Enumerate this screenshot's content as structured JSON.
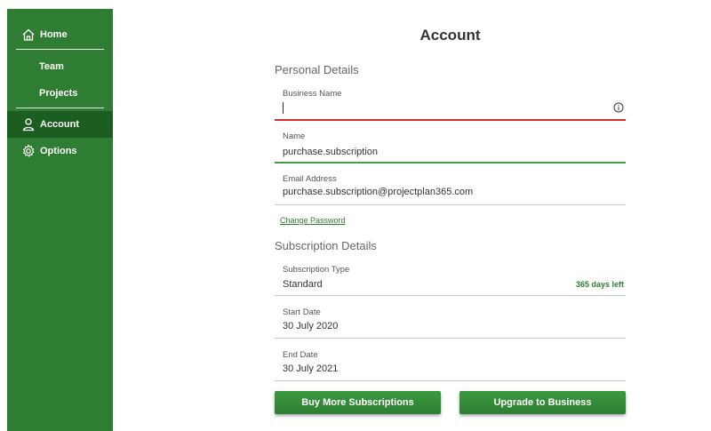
{
  "sidebar": {
    "items": [
      {
        "label": "Home",
        "icon": "home-icon"
      },
      {
        "label": "Team"
      },
      {
        "label": "Projects"
      },
      {
        "label": "Account",
        "icon": "person-icon",
        "active": true
      },
      {
        "label": "Options",
        "icon": "gear-icon"
      }
    ]
  },
  "main": {
    "title": "Account",
    "personal_section": "Personal Details",
    "business_name": {
      "label": "Business Name",
      "value": ""
    },
    "name": {
      "label": "Name",
      "value": "purchase.subscription"
    },
    "email": {
      "label": "Email Address",
      "value": "purchase.subscription@projectplan365.com"
    },
    "change_password": "Change Password",
    "subscription_section": "Subscription Details",
    "subscription_type": {
      "label": "Subscription Type",
      "value": "Standard",
      "days_left": "365 days left"
    },
    "start_date": {
      "label": "Start Date",
      "value": "30 July 2020"
    },
    "end_date": {
      "label": "End Date",
      "value": "30 July 2021"
    },
    "buttons": {
      "buy": "Buy More Subscriptions",
      "upgrade": "Upgrade to Business"
    }
  },
  "colors": {
    "brand": "#2e7d32",
    "active": "#1b5e20",
    "error": "#d32f2f",
    "success": "#43a047"
  }
}
